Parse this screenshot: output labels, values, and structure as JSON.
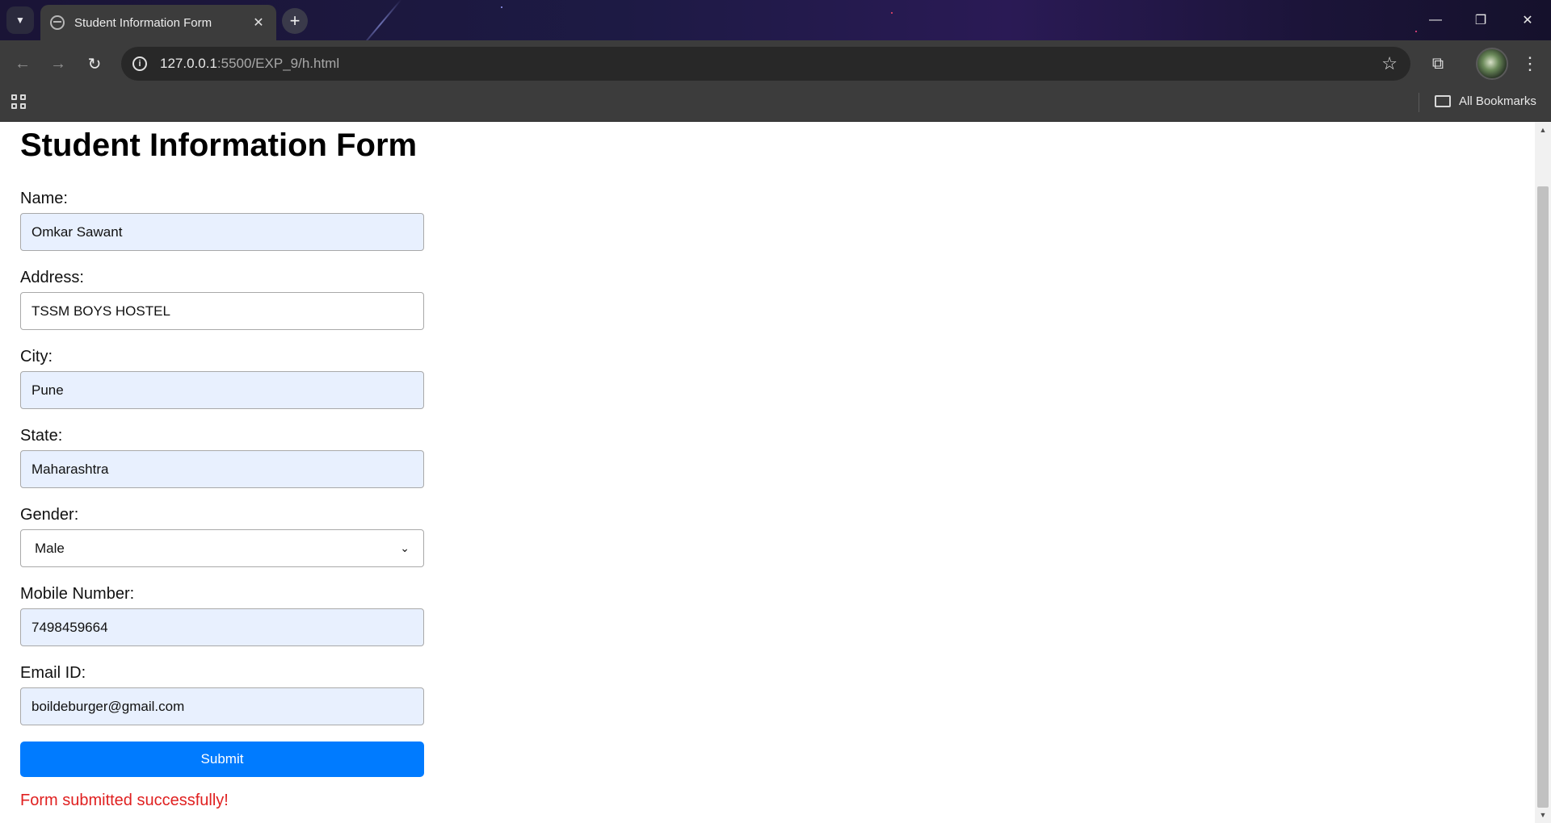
{
  "browser": {
    "tab_title": "Student Information Form",
    "tab_close": "✕",
    "new_tab": "+",
    "url_host": "127.0.0.1",
    "url_path": ":5500/EXP_9/h.html",
    "bookmarks_label": "All Bookmarks",
    "window_controls": {
      "minimize": "—",
      "restore": "❐",
      "close": "✕"
    },
    "nav": {
      "back": "←",
      "forward": "→",
      "reload": "↻"
    }
  },
  "form": {
    "title": "Student Information Form",
    "fields": {
      "name": {
        "label": "Name:",
        "value": "Omkar Sawant"
      },
      "address": {
        "label": "Address:",
        "value": "TSSM BOYS HOSTEL"
      },
      "city": {
        "label": "City:",
        "value": "Pune"
      },
      "state": {
        "label": "State:",
        "value": "Maharashtra"
      },
      "gender": {
        "label": "Gender:",
        "value": "Male"
      },
      "mobile": {
        "label": "Mobile Number:",
        "value": "7498459664"
      },
      "email": {
        "label": "Email ID:",
        "value": "boildeburger@gmail.com"
      }
    },
    "submit_label": "Submit",
    "success_message": "Form submitted successfully!"
  },
  "colors": {
    "autofill_bg": "#e8f0fe",
    "submit_bg": "#007bff",
    "success_text": "#e02020"
  }
}
